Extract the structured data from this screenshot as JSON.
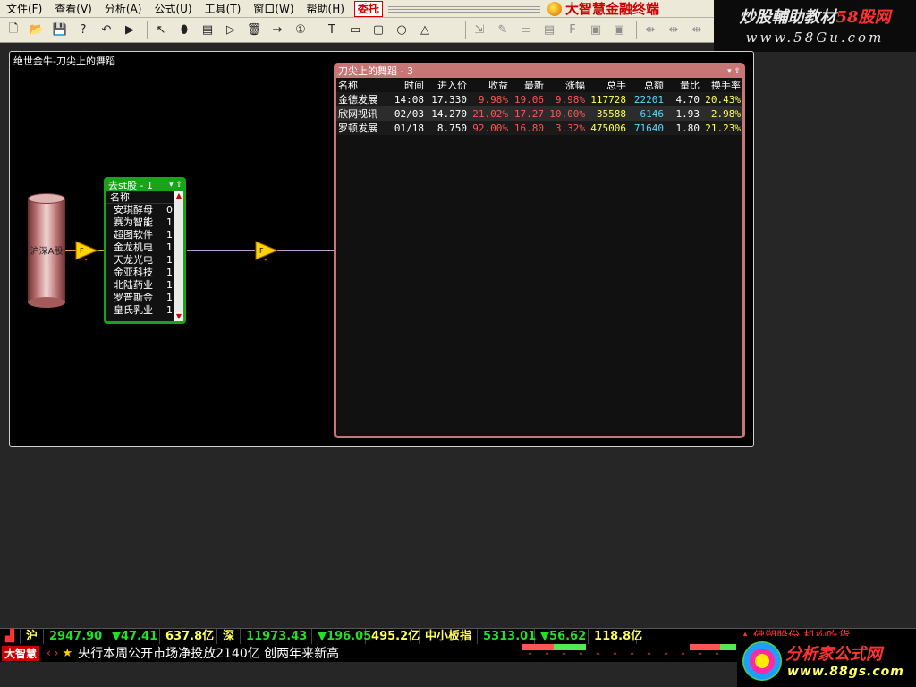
{
  "menubar": {
    "items": [
      "文件(F)",
      "查看(V)",
      "分析(A)",
      "公式(U)",
      "工具(T)",
      "窗口(W)",
      "帮助(H)"
    ],
    "delegate": "委托",
    "brand": "大智慧金融终端"
  },
  "toolbar": {
    "icons": [
      "new-icon",
      "open-icon",
      "save-icon",
      "help-icon",
      "undo-icon",
      "run-icon",
      "pointer-icon",
      "database-icon",
      "table-icon",
      "filter-icon",
      "trash-icon",
      "arrow-icon",
      "number-icon",
      "text-icon",
      "rect-icon",
      "round-rect-icon",
      "circle-icon",
      "triangle-icon",
      "line-icon",
      "tool-a-icon",
      "tool-b-icon",
      "tool-c-icon",
      "tool-d-icon",
      "tool-e-icon",
      "tool-f-icon",
      "tool-g-icon",
      "align-a-icon",
      "align-b-icon",
      "align-c-icon",
      "align-d-icon"
    ],
    "glyphs": [
      "🗋",
      "📂",
      "💾",
      "?",
      "↶",
      "▶",
      "↖",
      "⬮",
      "▤",
      "▷",
      "🗑",
      "→",
      "①",
      "T",
      "▭",
      "▢",
      "○",
      "△",
      "—",
      "⇲",
      "✎",
      "▭",
      "▤",
      "F",
      "▣",
      "▣",
      "⇹",
      "⇹",
      "⇹",
      "⇹"
    ]
  },
  "watermark_top": {
    "line1a": "炒股輔助教材",
    "line1b": "58股网",
    "line2": "www.58Gu.com"
  },
  "canvas": {
    "title": "绝世金牛-刀尖上的舞蹈"
  },
  "database": {
    "label": "沪深A股"
  },
  "filter_panel": {
    "title": "去st股 - 1",
    "column": "名称",
    "rows": [
      {
        "name": "安琪酵母",
        "cnt": "0"
      },
      {
        "name": "赛为智能",
        "cnt": "1"
      },
      {
        "name": "超图软件",
        "cnt": "1"
      },
      {
        "name": "金龙机电",
        "cnt": "1"
      },
      {
        "name": "天龙光电",
        "cnt": "1"
      },
      {
        "name": "金亚科技",
        "cnt": "1"
      },
      {
        "name": "北陆药业",
        "cnt": "1"
      },
      {
        "name": "罗普斯金",
        "cnt": "1"
      },
      {
        "name": "皇氏乳业",
        "cnt": "1"
      }
    ]
  },
  "result_panel": {
    "title": "刀尖上的舞蹈 - 3",
    "headers": [
      "名称",
      "时间",
      "进入价",
      "收益",
      "最新",
      "涨幅",
      "总手",
      "总额",
      "量比",
      "换手率"
    ],
    "rows": [
      [
        "金德发展",
        "14:08",
        "17.330",
        "9.98%",
        "19.06",
        "9.98%",
        "117728",
        "22201",
        "4.70",
        "20.43%"
      ],
      [
        "欣网视讯",
        "02/03",
        "14.270",
        "21.02%",
        "17.27",
        "10.00%",
        "35588",
        "6146",
        "1.93",
        "2.98%"
      ],
      [
        "罗顿发展",
        "01/18",
        "8.750",
        "92.00%",
        "16.80",
        "3.32%",
        "475006",
        "71640",
        "1.80",
        "21.23%"
      ]
    ],
    "col_colors": [
      "white",
      "white",
      "white",
      "red",
      "red",
      "red",
      "yellow",
      "cyan",
      "white",
      "yellow"
    ]
  },
  "ticker": {
    "sh_label": "沪",
    "sh_index": "2947.90",
    "sh_change": "▼47.41",
    "sh_amount": "637.8亿",
    "sz_label": "深",
    "sz_index": "11973.43",
    "sz_change": "▼196.05",
    "sz_amount": "495.2亿",
    "sme_label": "中小板指",
    "sme_index": "5313.01",
    "sme_change": "▼56.62",
    "sme_amount": "118.8亿",
    "extra": "佛塑股份 机构吃货",
    "logo": "大智慧",
    "nav": "‹ ›",
    "news": "央行本周公开市场净投放2140亿 创两年来新高"
  },
  "watermark_bottom": {
    "t1": "分析家公式网",
    "t2": "www.88gs.com"
  },
  "colors": {
    "green_panel": "#18a318",
    "red_panel": "#c77676",
    "up": "#ff5555",
    "down": "#22e022"
  }
}
